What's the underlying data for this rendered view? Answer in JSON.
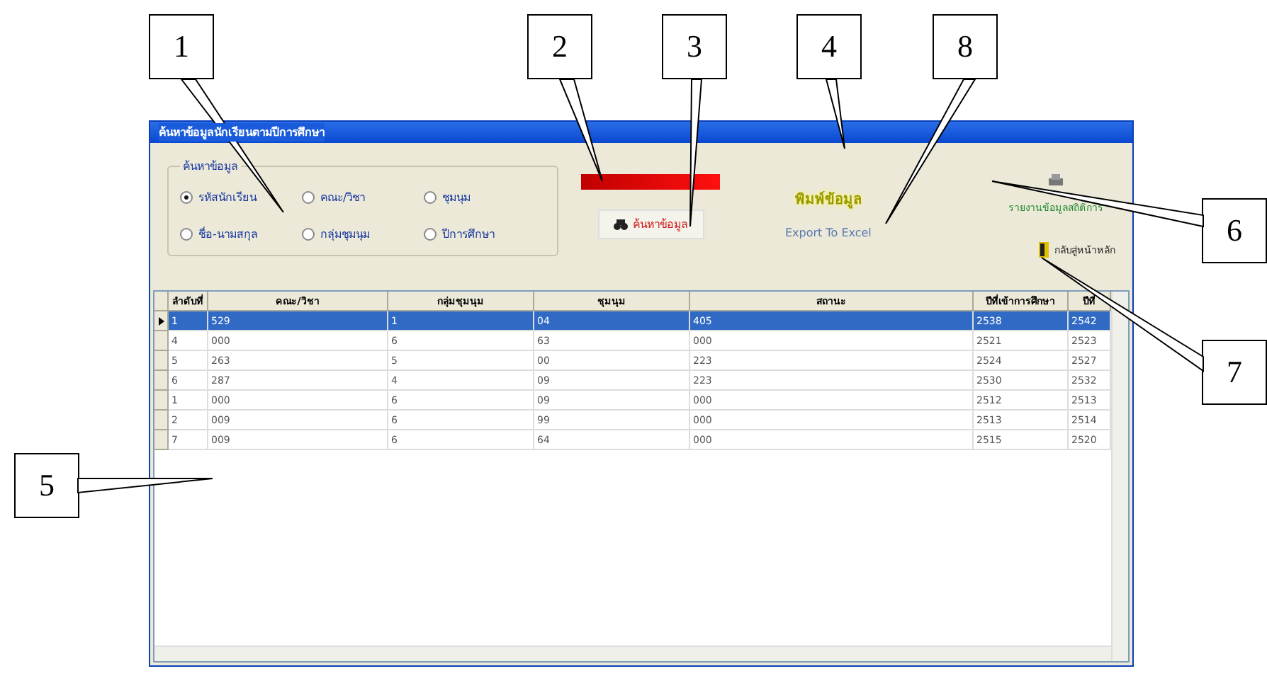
{
  "callouts": [
    {
      "label": "1"
    },
    {
      "label": "2"
    },
    {
      "label": "3"
    },
    {
      "label": "4"
    },
    {
      "label": "8"
    },
    {
      "label": "6"
    },
    {
      "label": "7"
    },
    {
      "label": "5"
    }
  ],
  "window": {
    "title": "ค้นหาข้อมูลนักเรียนตามปีการศึกษา"
  },
  "search_group": {
    "title": "ค้นหาข้อมูล",
    "options": [
      {
        "label": "รหัสนักเรียน",
        "selected": true
      },
      {
        "label": "คณะ/วิชา",
        "selected": false
      },
      {
        "label": "ชุมนุม",
        "selected": false
      },
      {
        "label": "ชื่อ-นามสกุล",
        "selected": false
      },
      {
        "label": "กลุ่มชุมนุม",
        "selected": false
      },
      {
        "label": "ปีการศึกษา",
        "selected": false
      }
    ]
  },
  "search_button": {
    "label": "ค้นหาข้อมูล"
  },
  "print_link": {
    "label": "พิมพ์ข้อมูล"
  },
  "export_link": {
    "label": "Export To Excel"
  },
  "report_link": {
    "label": "รายงานข้อมูลสถิติการ"
  },
  "back_link": {
    "label": "กลับสู่หน้าหลัก"
  },
  "table": {
    "columns": [
      "ลำดับที่",
      "คณะ/วิชา",
      "กลุ่มชุมนุม",
      "ชุมนุม",
      "สถานะ",
      "ปีที่เข้าการศึกษา",
      "ปีที่"
    ],
    "rows": [
      {
        "selected": true,
        "cells": [
          "1",
          "529",
          "1",
          "04",
          "405",
          "2538",
          "2542"
        ]
      },
      {
        "selected": false,
        "cells": [
          "4",
          "000",
          "6",
          "63",
          "000",
          "2521",
          "2523"
        ]
      },
      {
        "selected": false,
        "cells": [
          "5",
          "263",
          "5",
          "00",
          "223",
          "2524",
          "2527"
        ]
      },
      {
        "selected": false,
        "cells": [
          "6",
          "287",
          "4",
          "09",
          "223",
          "2530",
          "2532"
        ]
      },
      {
        "selected": false,
        "cells": [
          "1",
          "000",
          "6",
          "09",
          "000",
          "2512",
          "2513"
        ]
      },
      {
        "selected": false,
        "cells": [
          "2",
          "009",
          "6",
          "99",
          "000",
          "2513",
          "2514"
        ]
      },
      {
        "selected": false,
        "cells": [
          "7",
          "009",
          "6",
          "64",
          "000",
          "2515",
          "2520"
        ]
      }
    ]
  }
}
